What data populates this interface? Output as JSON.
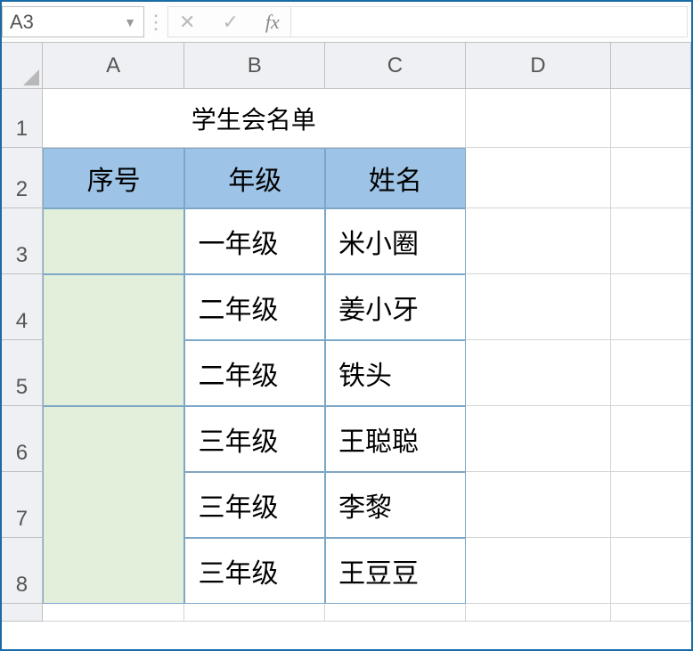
{
  "formula_bar": {
    "name_box": "A3",
    "cancel": "✕",
    "confirm": "✓",
    "fx": "fx",
    "input": ""
  },
  "columns": [
    "A",
    "B",
    "C",
    "D"
  ],
  "row_numbers": [
    "1",
    "2",
    "3",
    "4",
    "5",
    "6",
    "7",
    "8"
  ],
  "sheet": {
    "title": "学生会名单",
    "headers": {
      "a": "序号",
      "b": "年级",
      "c": "姓名"
    },
    "rows": [
      {
        "a": "",
        "b": "一年级",
        "c": "米小圈"
      },
      {
        "a": "",
        "b": "二年级",
        "c": "姜小牙"
      },
      {
        "a": "",
        "b": "二年级",
        "c": "铁头"
      },
      {
        "a": "",
        "b": "三年级",
        "c": "王聪聪"
      },
      {
        "a": "",
        "b": "三年级",
        "c": "李黎"
      },
      {
        "a": "",
        "b": "三年级",
        "c": "王豆豆"
      }
    ]
  }
}
